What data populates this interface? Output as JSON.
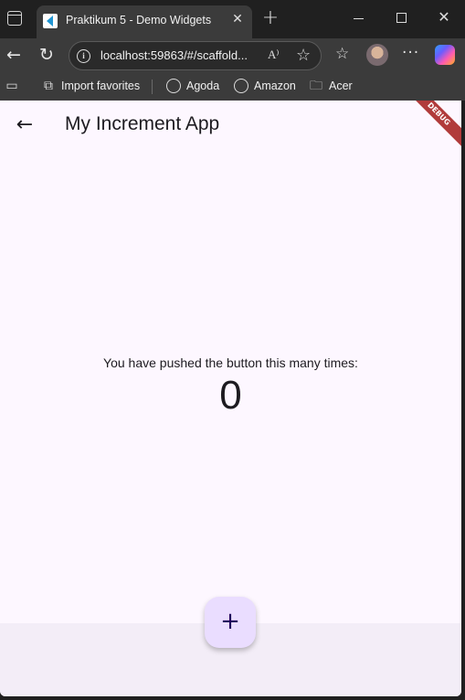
{
  "browser": {
    "tab": {
      "title": "Praktikum 5 - Demo Widgets",
      "close_glyph": "✕",
      "favicon": "flutter-icon"
    },
    "new_tab_glyph": "+",
    "window_controls": {
      "close_glyph": "✕"
    },
    "toolbar": {
      "back_glyph": "←",
      "reload_glyph": "↻",
      "url": "localhost:59863/#/scaffold...",
      "read_aloud_glyph": "A⁾",
      "star_glyph": "☆",
      "favorites_glyph": "☆",
      "more_glyph": "···"
    },
    "bookmarks": [
      {
        "label": "Import favorites",
        "icon": "import-icon"
      },
      {
        "label": "Agoda",
        "icon": "globe-icon"
      },
      {
        "label": "Amazon",
        "icon": "globe-icon"
      },
      {
        "label": "Acer",
        "icon": "folder-icon"
      }
    ]
  },
  "app": {
    "back_glyph": "←",
    "title": "My Increment App",
    "debug_banner": "DEBUG",
    "counter_label": "You have pushed the button this many times:",
    "counter_value": "0",
    "fab_glyph": "+",
    "colors": {
      "background": "#fdf7ff",
      "bottom_area": "#f3edf7",
      "fab": "#eaddff",
      "debug_banner": "#b13b3b"
    }
  }
}
